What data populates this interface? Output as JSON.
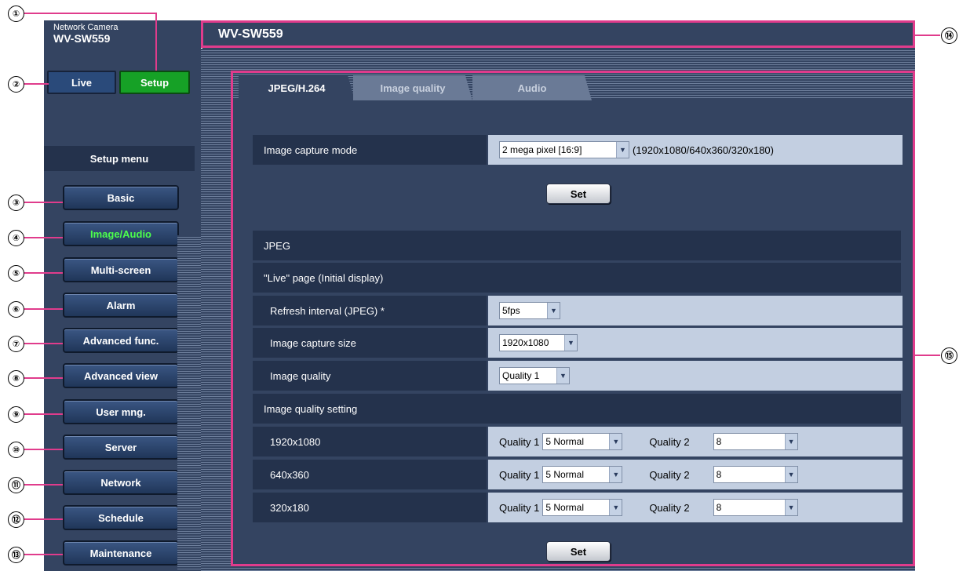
{
  "header": {
    "camera_type": "Network Camera",
    "model": "WV-SW559",
    "title": "WV-SW559"
  },
  "mode_buttons": {
    "live": "Live",
    "setup": "Setup"
  },
  "menu": {
    "label": "Setup menu",
    "items": [
      {
        "label": "Basic",
        "active": false
      },
      {
        "label": "Image/Audio",
        "active": true
      },
      {
        "label": "Multi-screen",
        "active": false
      },
      {
        "label": "Alarm",
        "active": false
      },
      {
        "label": "Advanced func.",
        "active": false
      },
      {
        "label": "Advanced view",
        "active": false
      },
      {
        "label": "User mng.",
        "active": false
      },
      {
        "label": "Server",
        "active": false
      },
      {
        "label": "Network",
        "active": false
      },
      {
        "label": "Schedule",
        "active": false
      },
      {
        "label": "Maintenance",
        "active": false
      }
    ]
  },
  "tabs": [
    {
      "label": "JPEG/H.264",
      "active": true
    },
    {
      "label": "Image quality",
      "active": false
    },
    {
      "label": "Audio",
      "active": false
    }
  ],
  "capture_mode": {
    "label": "Image capture mode",
    "value": "2 mega pixel [16:9]",
    "note": "(1920x1080/640x360/320x180)"
  },
  "set_label": "Set",
  "jpeg": {
    "section": "JPEG",
    "live_page": "\"Live\" page (Initial display)",
    "refresh": {
      "label": "Refresh interval (JPEG) *",
      "value": "5fps"
    },
    "capture_size": {
      "label": "Image capture size",
      "value": "1920x1080"
    },
    "image_quality": {
      "label": "Image quality",
      "value": "Quality 1"
    },
    "quality_setting": "Image quality setting",
    "q1_label": "Quality 1",
    "q2_label": "Quality 2",
    "rows": [
      {
        "res": "1920x1080",
        "q1": "5 Normal",
        "q2": "8"
      },
      {
        "res": "640x360",
        "q1": "5 Normal",
        "q2": "8"
      },
      {
        "res": "320x180",
        "q1": "5 Normal",
        "q2": "8"
      }
    ]
  },
  "callouts": [
    "①",
    "②",
    "③",
    "④",
    "⑤",
    "⑥",
    "⑦",
    "⑧",
    "⑨",
    "⑩",
    "⑪",
    "⑫",
    "⑬",
    "⑭",
    "⑮"
  ],
  "colors": {
    "frame": "#344461",
    "callout_line": "#e03c8c",
    "active_green": "#16a126",
    "active_text": "#4cff4c"
  }
}
